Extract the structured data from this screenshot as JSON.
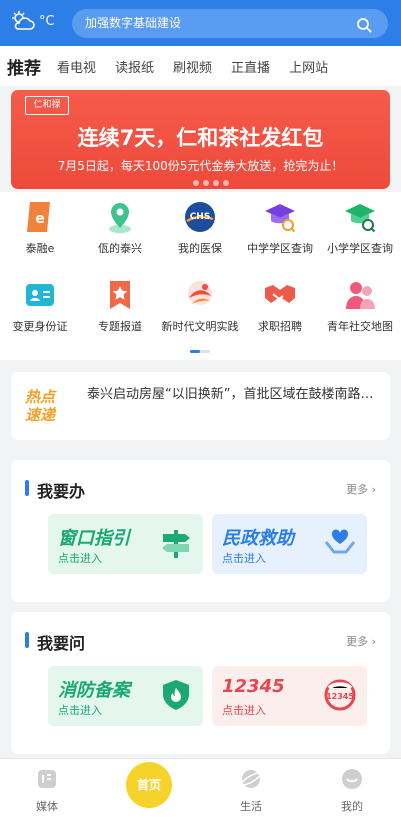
{
  "header": {
    "weather_unit": "°C",
    "search_placeholder": "加强数字基础建设"
  },
  "tabs": [
    "推荐",
    "看电视",
    "读报纸",
    "刷视频",
    "正直播",
    "上网站"
  ],
  "banner": {
    "logo_text": "仁和禄",
    "title": "连续7天，仁和茶社发红包",
    "subtitle": "7月5日起，每天100份5元代金券大放送，抢完为止！"
  },
  "grid": [
    {
      "label": "泰融e",
      "icon": "taironge-icon",
      "color": "#f0823a"
    },
    {
      "label": "佤的泰兴",
      "icon": "map-pin-icon",
      "color": "#3cc48c"
    },
    {
      "label": "我的医保",
      "icon": "chs-medical-insurance-icon",
      "color": "#1f4d9e"
    },
    {
      "label": "中学学区查询",
      "icon": "graduation-cap-search-icon",
      "color": "#7a3fe0"
    },
    {
      "label": "小学学区查询",
      "icon": "graduation-cap-search-green-icon",
      "color": "#1fb36b"
    },
    {
      "label": "变更身份证",
      "icon": "id-card-icon",
      "color": "#22b6d6"
    },
    {
      "label": "专题报道",
      "icon": "star-bookmark-icon",
      "color": "#f0694a"
    },
    {
      "label": "新时代文明实践",
      "icon": "civilization-icon",
      "color": "#ef4c3a"
    },
    {
      "label": "求职招聘",
      "icon": "handshake-icon",
      "color": "#ef5a4a"
    },
    {
      "label": "青年社交地图",
      "icon": "people-icon",
      "color": "#f05a7a"
    }
  ],
  "hot": {
    "label_line1": "热点",
    "label_line2": "速递",
    "news": "泰兴启动房屋“以旧换新”，首批区域在鼓楼南路…"
  },
  "section_do": {
    "title": "我要办",
    "more": "更多",
    "tiles": [
      {
        "title": "窗口指引",
        "sub": "点击进入",
        "icon": "signpost-icon",
        "color": "#1aa874",
        "bg": "#e4f6ee"
      },
      {
        "title": "民政救助",
        "sub": "点击进入",
        "icon": "heart-hands-icon",
        "color": "#2d7ee6",
        "bg": "#e6f1fd"
      }
    ]
  },
  "section_ask": {
    "title": "我要问",
    "more": "更多",
    "tiles": [
      {
        "title": "消防备案",
        "sub": "点击进入",
        "icon": "fire-shield-icon",
        "color": "#1aa874",
        "bg": "#e4f6ee"
      },
      {
        "title": "12345",
        "sub": "点击进入",
        "icon": "hotline-12345-icon",
        "color": "#e8454c",
        "bg": "#fdeeee"
      }
    ]
  },
  "tabbar": {
    "media": "媒体",
    "home": "首页",
    "life": "生活",
    "mine": "我的"
  }
}
